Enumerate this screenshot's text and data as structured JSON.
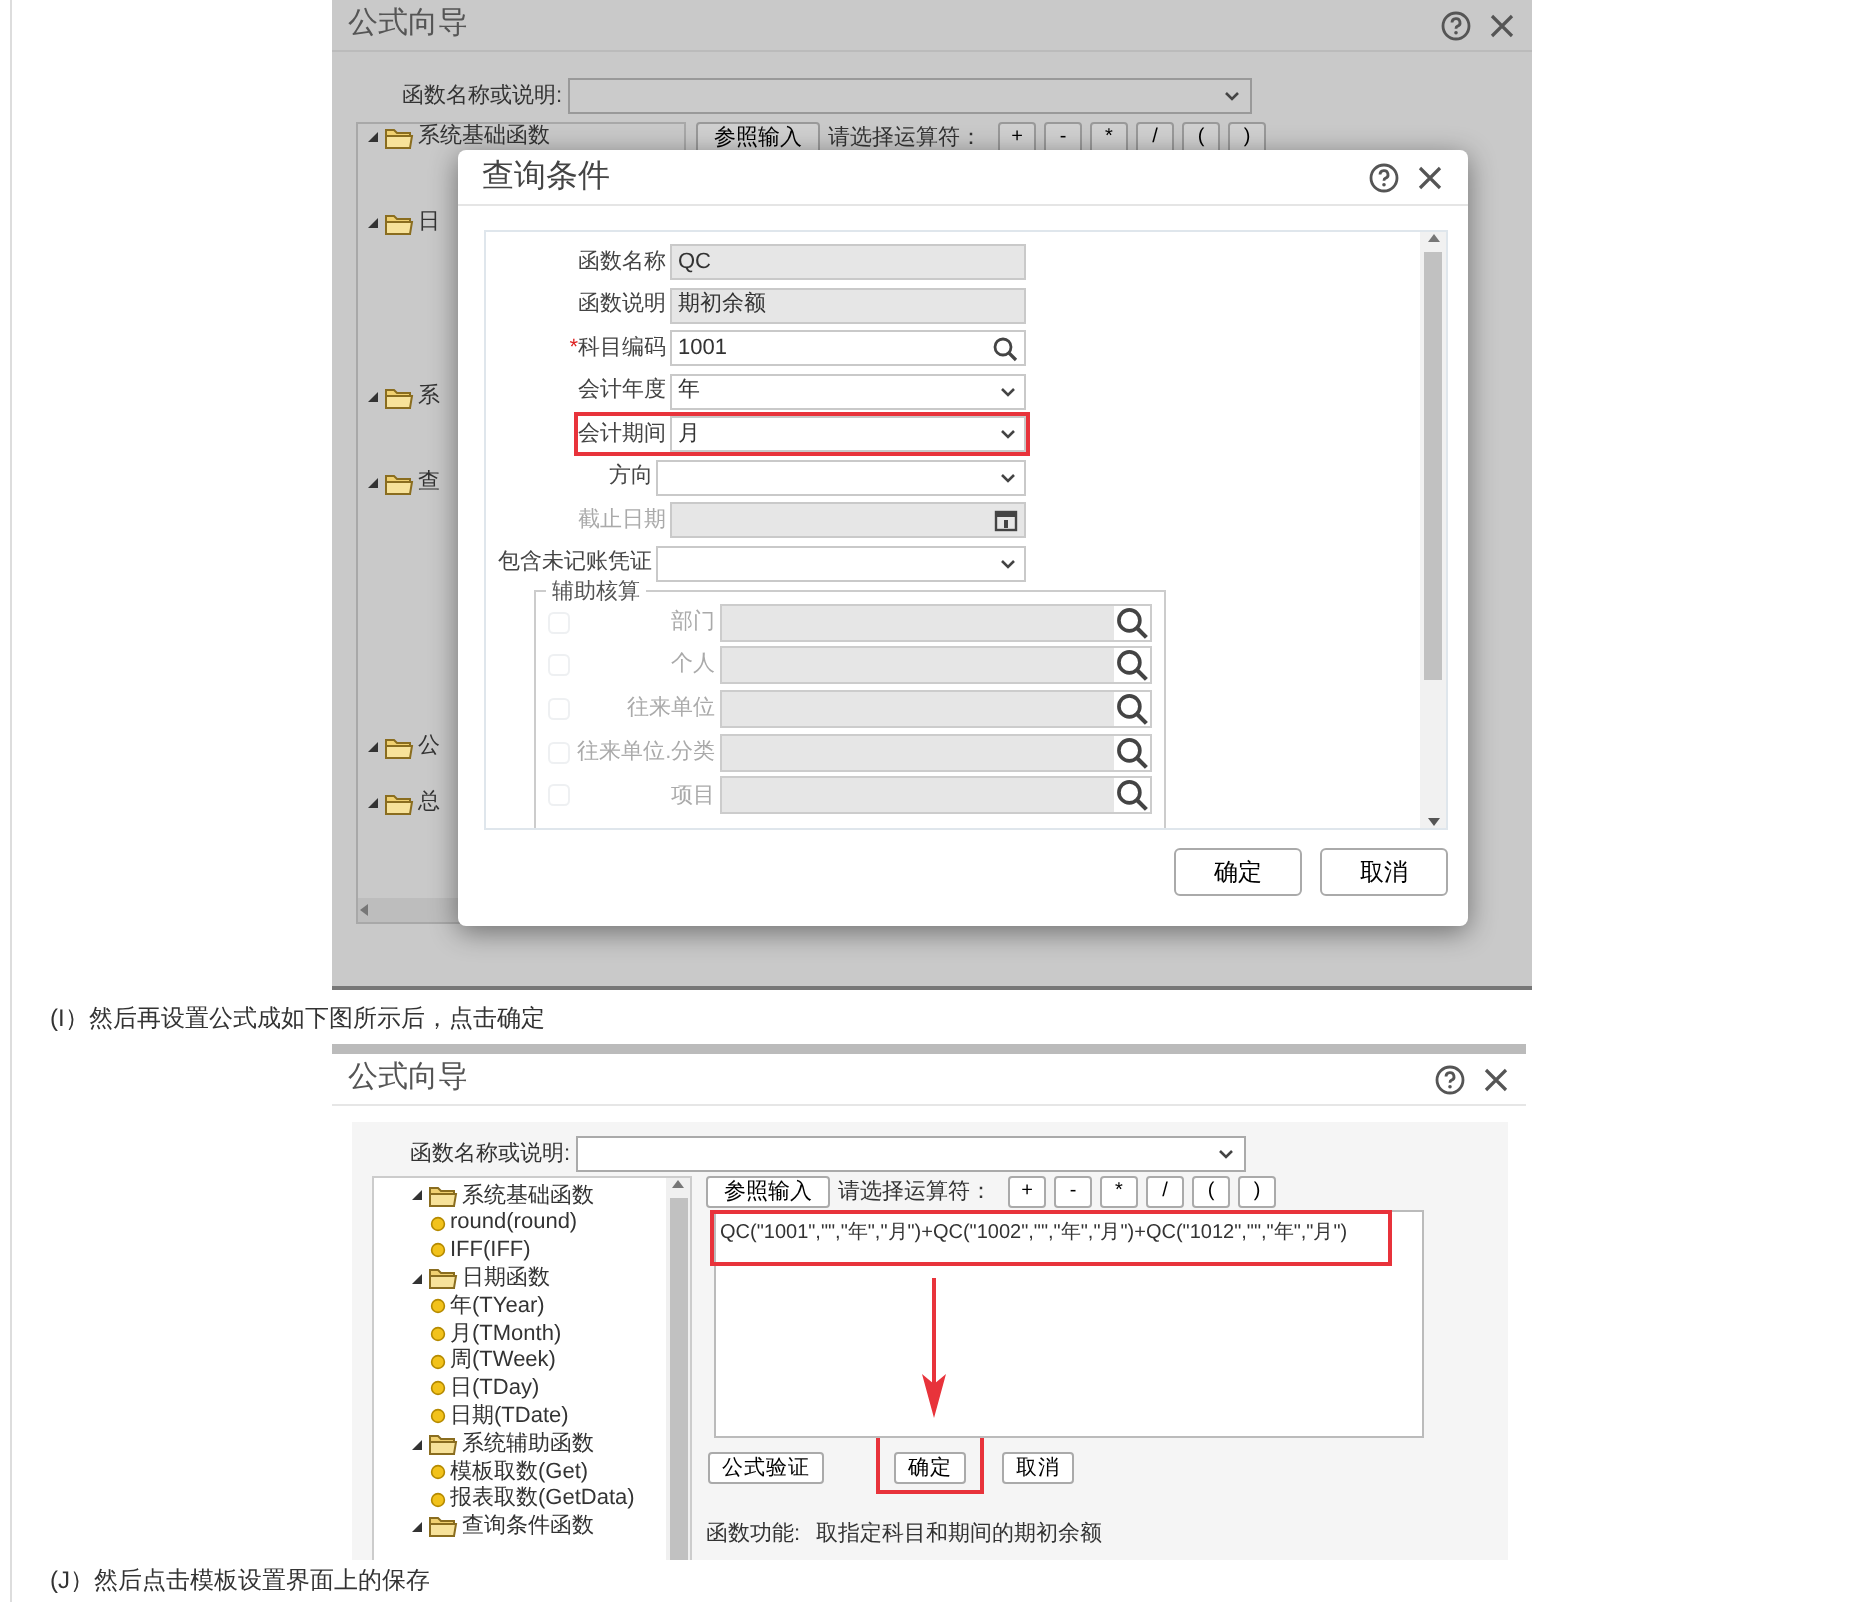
{
  "figure_1": {
    "window": {
      "title": "公式向导"
    },
    "search": {
      "label": "函数名称或说明:"
    },
    "tree": [
      {
        "label": "系统基础函数",
        "expanded": true
      },
      {
        "label": "日",
        "expanded": true
      },
      {
        "label": "系",
        "expanded": true
      },
      {
        "label": "查",
        "expanded": true
      },
      {
        "label": "公",
        "expanded": true
      },
      {
        "label": "总",
        "expanded": true
      }
    ],
    "toolbar": {
      "ref_button": "参照输入",
      "operator_label": "请选择运算符：",
      "operators": [
        "+",
        "-",
        "*",
        "/",
        "(",
        ")"
      ]
    },
    "dialog": {
      "title": "查询条件",
      "fields": [
        {
          "label": "函数名称",
          "value": "QC",
          "kind": "text",
          "disabled": true,
          "highlighted": false
        },
        {
          "label": "函数说明",
          "value": "期初余额",
          "kind": "text",
          "disabled": true,
          "highlighted": false
        },
        {
          "label": "科目编码",
          "required_mark": "*",
          "value": "1001",
          "kind": "lookup",
          "disabled": false,
          "highlighted": false
        },
        {
          "label": "会计年度",
          "value": "年",
          "kind": "select",
          "disabled": false,
          "highlighted": false
        },
        {
          "label": "会计期间",
          "value": "月",
          "kind": "select",
          "disabled": false,
          "highlighted": true
        },
        {
          "label": "方向",
          "kind": "select",
          "disabled": false,
          "highlighted": false
        },
        {
          "label": "截止日期",
          "kind": "date",
          "disabled": true,
          "highlighted": false
        },
        {
          "label": "包含未记账凭证",
          "kind": "select",
          "disabled": false,
          "highlighted": false
        }
      ],
      "aux": {
        "legend": "辅助核算",
        "rows": [
          {
            "label": "部门",
            "checked": false
          },
          {
            "label": "个人",
            "checked": false
          },
          {
            "label": "往来单位",
            "checked": false
          },
          {
            "label": "往来单位.分类",
            "checked": false
          },
          {
            "label": "项目",
            "checked": false
          }
        ]
      },
      "buttons": [
        "确定",
        "取消"
      ]
    }
  },
  "caption_1": "(I）然后再设置公式成如下图所示后，点击确定",
  "figure_2": {
    "window": {
      "title": "公式向导"
    },
    "search": {
      "label": "函数名称或说明:"
    },
    "tree": [
      {
        "label": "系统基础函数",
        "expanded": true,
        "children": [
          {
            "label": "round(round)"
          },
          {
            "label": "IFF(IFF)"
          }
        ]
      },
      {
        "label": "日期函数",
        "expanded": true,
        "children": [
          {
            "label": "年(TYear)"
          },
          {
            "label": "月(TMonth)"
          },
          {
            "label": "周(TWeek)"
          },
          {
            "label": "日(TDay)"
          },
          {
            "label": "日期(TDate)"
          }
        ]
      },
      {
        "label": "系统辅助函数",
        "expanded": true,
        "children": [
          {
            "label": "模板取数(Get)"
          },
          {
            "label": "报表取数(GetData)"
          }
        ]
      },
      {
        "label": "查询条件函数",
        "expanded": true
      }
    ],
    "toolbar": {
      "ref_button": "参照输入",
      "operator_label": "请选择运算符：",
      "operators": [
        "+",
        "-",
        "*",
        "/",
        "(",
        ")"
      ]
    },
    "formula": {
      "value": "QC(\"1001\",\"\",\"年\",\"月\")+QC(\"1002\",\"\",\"年\",\"月\")+QC(\"1012\",\"\",\"年\",\"月\")",
      "highlighted": true
    },
    "buttons": [
      {
        "label": "公式验证",
        "highlighted": false
      },
      {
        "label": "确定",
        "highlighted": true
      },
      {
        "label": "取消",
        "highlighted": false
      }
    ],
    "description": {
      "label": "函数功能:",
      "text": "取指定科目和期间的期初余额"
    }
  },
  "caption_2": "(J）然后点击模板设置界面上的保存"
}
